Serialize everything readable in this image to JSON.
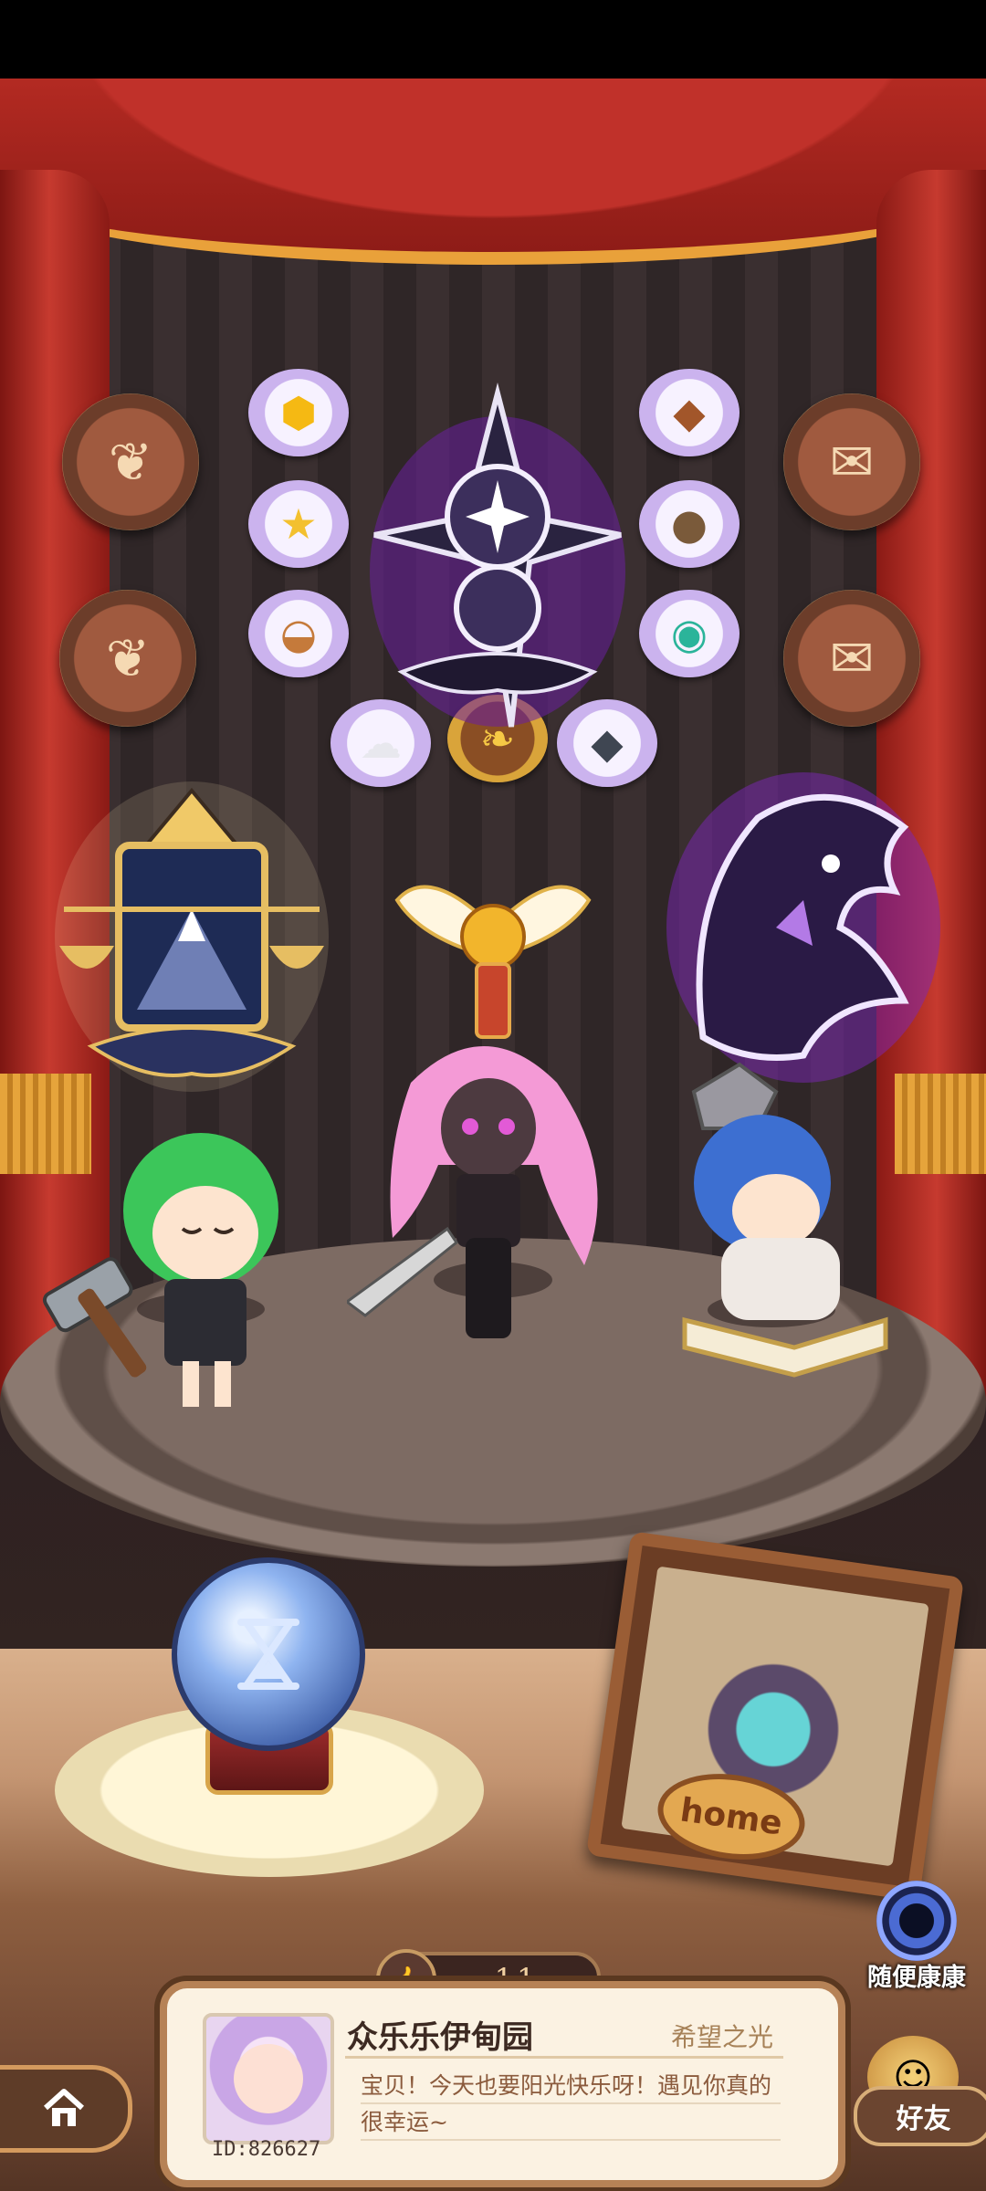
{
  "stage": {
    "emblem_center": "compass-star-emblem",
    "emblem_left": "scales-lantern-emblem",
    "emblem_right": "dragon-emblem"
  },
  "medallions": [
    "crest-medallion",
    "crest-medallion",
    "scroll-medallion",
    "scroll-medallion"
  ],
  "items": [
    "honeycomb",
    "star",
    "shell",
    "ore",
    "stones",
    "ring",
    "cotton",
    "golden-bird",
    "coal"
  ],
  "scene": {
    "home_label": "home"
  },
  "likes": {
    "count": "11"
  },
  "profile": {
    "name": "众乐乐伊甸园",
    "title": "希望之光",
    "motto": "宝贝！今天也要阳光快乐呀！遇见你真的很幸运~",
    "id": "ID:826627"
  },
  "side": {
    "portal_label": "随便康康",
    "friends_label": "好友"
  },
  "colors": {
    "curtain": "#b32a22",
    "gold": "#e9a13a",
    "card": "#fbf2e2"
  }
}
